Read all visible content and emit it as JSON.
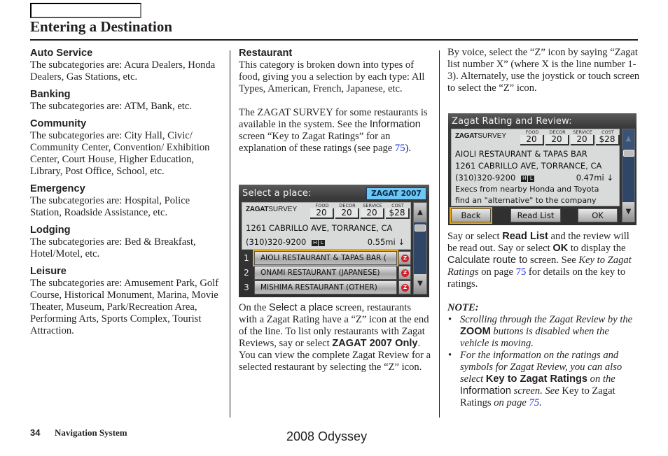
{
  "header": {
    "tab_label": "",
    "title": "Entering a Destination"
  },
  "col1": {
    "sections": [
      {
        "heading": "Auto Service",
        "body": "The subcategories are: Acura Dealers, Honda Dealers, Gas Stations, etc."
      },
      {
        "heading": "Banking",
        "body": "The subcategories are: ATM, Bank, etc."
      },
      {
        "heading": "Community",
        "body": "The subcategories are: City Hall, Civic/ Community Center, Convention/ Exhibition Center, Court House, Higher Education, Library, Post Office, School, etc."
      },
      {
        "heading": "Emergency",
        "body": "The subcategories are: Hospital, Police Station, Roadside Assistance, etc."
      },
      {
        "heading": "Lodging",
        "body": "The subcategories are: Bed & Breakfast, Hotel/Motel, etc."
      },
      {
        "heading": "Leisure",
        "body": "The subcategories are: Amusement Park, Golf Course, Historical Monument, Marina, Movie Theater, Museum, Park/Recreation Area, Performing Arts, Sports Complex, Tourist Attraction."
      }
    ]
  },
  "col2": {
    "heading": "Restaurant",
    "para1": "This category is broken down into types of food, giving you a selection by each type: All Types, American, French, Japanese, etc.",
    "para2": {
      "t1": "The ZAGAT SURVEY for some restaurants is available in the system. See the ",
      "ui1": "Information",
      "t2": " screen “Key to Zagat Ratings” for an explanation of these ratings (see page ",
      "link": "75",
      "t3": ")."
    },
    "para3": {
      "t1": "On the ",
      "ui1": "Select a place",
      "t2": " screen, restaurants with a Zagat Rating have a “Z” icon at the end of the line. To list only restaurants with Zagat Reviews, say or select ",
      "btn": "ZAGAT 2007 Only",
      "t3": ". You can view the complete Zagat Review for a selected restaurant by selecting the “Z” icon."
    }
  },
  "screen1": {
    "title": "Select a place:",
    "zagat_only_button": "ZAGAT 2007 Only",
    "logo_bold": "ZAGAT",
    "logo_rest": "SURVEY",
    "ratings": [
      {
        "label": "FOOD",
        "value": "20"
      },
      {
        "label": "DECOR",
        "value": "20"
      },
      {
        "label": "SERVICE",
        "value": "20"
      },
      {
        "label": "COST",
        "value": "$28"
      }
    ],
    "address": "1261 CABRILLO AVE, TORRANCE, CA",
    "phone": "(310)320-9200",
    "icon_h": "H",
    "icon_l": "L",
    "distance": "0.55mi",
    "direction_glyph": "↓",
    "rows": [
      {
        "num": "1",
        "name": "AIOLI RESTAURANT & TAPAS BAR (",
        "z": "Z",
        "selected": true
      },
      {
        "num": "2",
        "name": "ONAMI RESTAURANT (JAPANESE)",
        "z": "Z",
        "selected": false
      },
      {
        "num": "3",
        "name": "MISHIMA RESTAURANT (OTHER)",
        "z": "Z",
        "selected": false
      }
    ],
    "scroll_up": "▲",
    "scroll_down": "▼"
  },
  "col3": {
    "para1": "By voice, select the “Z” icon by  saying “Zagat list number X” (where X is the line number 1-3). Alternately, use the joystick or touch screen to select the “Z” icon.",
    "para2": {
      "t1": "Say or select ",
      "b1": "Read List",
      "t2": " and the review will be read out. Say or select ",
      "b2": "OK",
      "t3": " to display the ",
      "ui1": "Calculate route to",
      "t4": " screen. See ",
      "i1": "Key to Zagat Ratings",
      "t5": " on page ",
      "link": "75",
      "t6": " for details on the key to ratings."
    },
    "note_title": "NOTE:",
    "note1": {
      "t1": "Scrolling through the Zagat Review by the ",
      "b1": "ZOOM",
      "t2": " buttons is disabled when the vehicle is moving."
    },
    "note2": {
      "t1": "For the information on the ratings and symbols for Zagat Review, you can also select ",
      "b1": "Key to Zagat Ratings",
      "t2": " on the ",
      "ui1": "Information",
      "t3": " screen. See ",
      "u1": "Key to Zagat Ratings",
      "t4": " on page ",
      "link": "75",
      "t5": "."
    }
  },
  "screen2": {
    "title": "Zagat Rating and Review:",
    "logo_bold": "ZAGAT",
    "logo_rest": "SURVEY",
    "ratings": [
      {
        "label": "FOOD",
        "value": "20"
      },
      {
        "label": "DECOR",
        "value": "20"
      },
      {
        "label": "SERVICE",
        "value": "20"
      },
      {
        "label": "COST",
        "value": "$28"
      }
    ],
    "name": "AIOLI RESTAURANT & TAPAS BAR",
    "address": "1261 CABRILLO AVE, TORRANCE, CA",
    "phone": "(310)320-9200",
    "icon_h": "H",
    "icon_l": "L",
    "distance": "0.47mi",
    "direction_glyph": "↓",
    "review_line1": "Execs from nearby Honda and Toyota",
    "review_line2": "find an \"alternative\" to the company",
    "back_button": "Back",
    "read_list_button": "Read List",
    "ok_button": "OK",
    "scroll_up": "▲",
    "scroll_down": "▼"
  },
  "footer": {
    "page_number": "34",
    "section": "Navigation System",
    "model": "2008  Odyssey"
  }
}
